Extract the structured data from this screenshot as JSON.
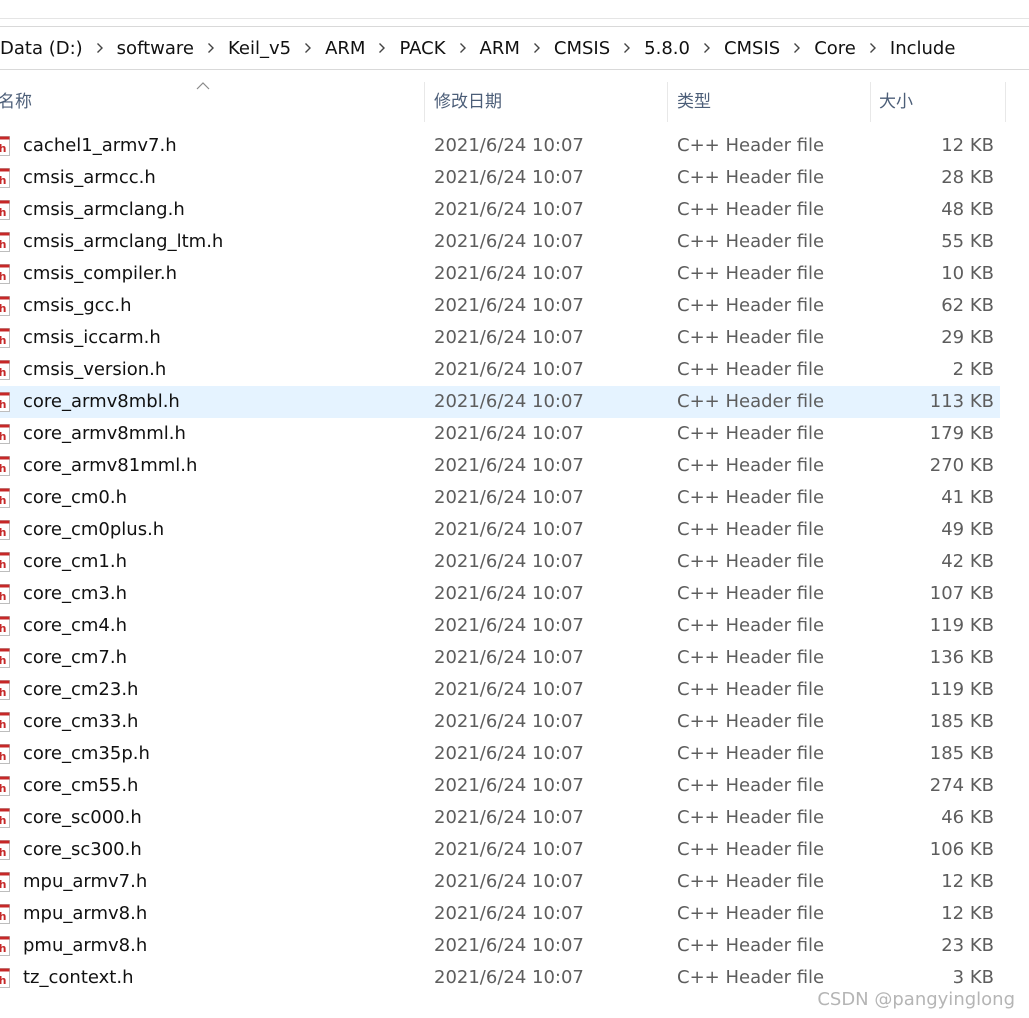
{
  "breadcrumb": [
    "Data (D:)",
    "software",
    "Keil_v5",
    "ARM",
    "PACK",
    "ARM",
    "CMSIS",
    "5.8.0",
    "CMSIS",
    "Core",
    "Include"
  ],
  "columns": {
    "name": "名称",
    "date": "修改日期",
    "type": "类型",
    "size": "大小"
  },
  "sort": {
    "column": "name",
    "direction": "ascending"
  },
  "selected_row": 8,
  "files": [
    {
      "name": "cachel1_armv7.h",
      "date": "2021/6/24 10:07",
      "type": "C++ Header file",
      "size": "12 KB"
    },
    {
      "name": "cmsis_armcc.h",
      "date": "2021/6/24 10:07",
      "type": "C++ Header file",
      "size": "28 KB"
    },
    {
      "name": "cmsis_armclang.h",
      "date": "2021/6/24 10:07",
      "type": "C++ Header file",
      "size": "48 KB"
    },
    {
      "name": "cmsis_armclang_ltm.h",
      "date": "2021/6/24 10:07",
      "type": "C++ Header file",
      "size": "55 KB"
    },
    {
      "name": "cmsis_compiler.h",
      "date": "2021/6/24 10:07",
      "type": "C++ Header file",
      "size": "10 KB"
    },
    {
      "name": "cmsis_gcc.h",
      "date": "2021/6/24 10:07",
      "type": "C++ Header file",
      "size": "62 KB"
    },
    {
      "name": "cmsis_iccarm.h",
      "date": "2021/6/24 10:07",
      "type": "C++ Header file",
      "size": "29 KB"
    },
    {
      "name": "cmsis_version.h",
      "date": "2021/6/24 10:07",
      "type": "C++ Header file",
      "size": "2 KB"
    },
    {
      "name": "core_armv8mbl.h",
      "date": "2021/6/24 10:07",
      "type": "C++ Header file",
      "size": "113 KB"
    },
    {
      "name": "core_armv8mml.h",
      "date": "2021/6/24 10:07",
      "type": "C++ Header file",
      "size": "179 KB"
    },
    {
      "name": "core_armv81mml.h",
      "date": "2021/6/24 10:07",
      "type": "C++ Header file",
      "size": "270 KB"
    },
    {
      "name": "core_cm0.h",
      "date": "2021/6/24 10:07",
      "type": "C++ Header file",
      "size": "41 KB"
    },
    {
      "name": "core_cm0plus.h",
      "date": "2021/6/24 10:07",
      "type": "C++ Header file",
      "size": "49 KB"
    },
    {
      "name": "core_cm1.h",
      "date": "2021/6/24 10:07",
      "type": "C++ Header file",
      "size": "42 KB"
    },
    {
      "name": "core_cm3.h",
      "date": "2021/6/24 10:07",
      "type": "C++ Header file",
      "size": "107 KB"
    },
    {
      "name": "core_cm4.h",
      "date": "2021/6/24 10:07",
      "type": "C++ Header file",
      "size": "119 KB"
    },
    {
      "name": "core_cm7.h",
      "date": "2021/6/24 10:07",
      "type": "C++ Header file",
      "size": "136 KB"
    },
    {
      "name": "core_cm23.h",
      "date": "2021/6/24 10:07",
      "type": "C++ Header file",
      "size": "119 KB"
    },
    {
      "name": "core_cm33.h",
      "date": "2021/6/24 10:07",
      "type": "C++ Header file",
      "size": "185 KB"
    },
    {
      "name": "core_cm35p.h",
      "date": "2021/6/24 10:07",
      "type": "C++ Header file",
      "size": "185 KB"
    },
    {
      "name": "core_cm55.h",
      "date": "2021/6/24 10:07",
      "type": "C++ Header file",
      "size": "274 KB"
    },
    {
      "name": "core_sc000.h",
      "date": "2021/6/24 10:07",
      "type": "C++ Header file",
      "size": "46 KB"
    },
    {
      "name": "core_sc300.h",
      "date": "2021/6/24 10:07",
      "type": "C++ Header file",
      "size": "106 KB"
    },
    {
      "name": "mpu_armv7.h",
      "date": "2021/6/24 10:07",
      "type": "C++ Header file",
      "size": "12 KB"
    },
    {
      "name": "mpu_armv8.h",
      "date": "2021/6/24 10:07",
      "type": "C++ Header file",
      "size": "12 KB"
    },
    {
      "name": "pmu_armv8.h",
      "date": "2021/6/24 10:07",
      "type": "C++ Header file",
      "size": "23 KB"
    },
    {
      "name": "tz_context.h",
      "date": "2021/6/24 10:07",
      "type": "C++ Header file",
      "size": "3 KB"
    }
  ],
  "file_icon": {
    "name": "cpp-header-file-icon",
    "color": "#c62828"
  },
  "watermark": "CSDN @pangyinglong"
}
